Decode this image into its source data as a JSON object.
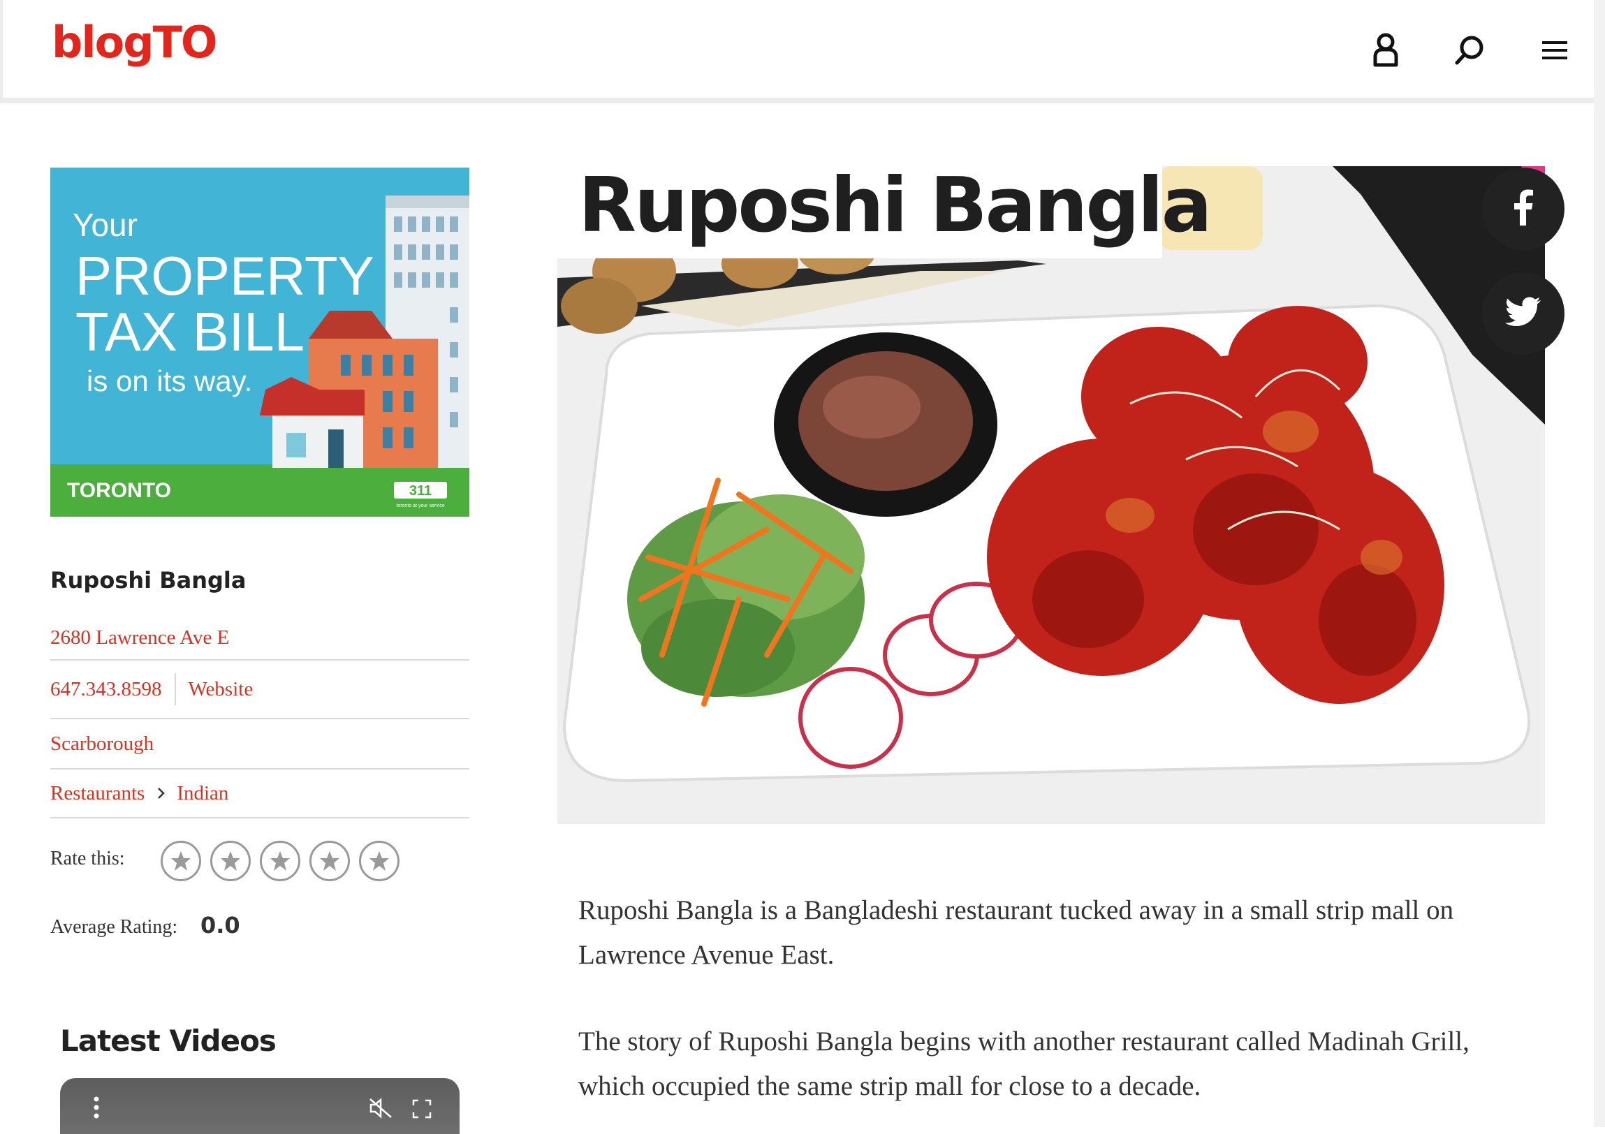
{
  "header": {
    "logo": "blogTO",
    "icons": [
      "user-icon",
      "search-icon",
      "menu-icon"
    ]
  },
  "ad": {
    "line1": "Your",
    "line2": "PROPERTY",
    "line3": "TAX BILL",
    "line4": "is on its way.",
    "brand": "TORONTO",
    "badge": "311",
    "badge_sub": "toronto at your service"
  },
  "sidebar": {
    "name": "Ruposhi Bangla",
    "address": "2680 Lawrence Ave E",
    "phone": "647.343.8598",
    "website": "Website",
    "neighbourhood": "Scarborough",
    "category": "Restaurants",
    "subcategory": "Indian",
    "rate_label": "Rate this:",
    "rating_stars": 0,
    "avg_label": "Average Rating:",
    "avg_value": "0.0"
  },
  "latest_videos": {
    "title": "Latest Videos"
  },
  "article": {
    "title": "Ruposhi Bangla",
    "paragraphs": [
      "Ruposhi Bangla is a Bangladeshi restaurant tucked away in a small strip mall on Lawrence Avenue East.",
      "The story of Ruposhi Bangla begins with another restaurant called Madinah Grill, which occupied the same strip mall for close to a decade."
    ]
  },
  "social": [
    "facebook-icon",
    "twitter-icon"
  ],
  "colors": {
    "brand_red": "#e3261b",
    "link_red": "#d8311f",
    "social_bg": "#222222"
  }
}
